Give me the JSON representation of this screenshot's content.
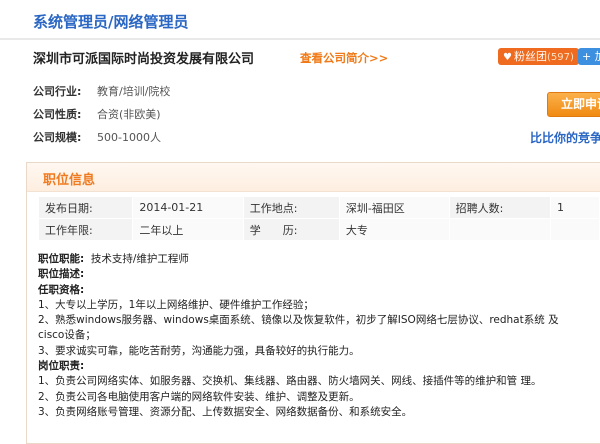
{
  "job": {
    "title": "系统管理员/网络管理员"
  },
  "company": {
    "name": "深圳市可派国际时尚投资发展有限公司",
    "intro_link": "查看公司简介>>",
    "fans_label": "粉丝团",
    "fans_count": "(597)",
    "follow_label": "+ 加关注",
    "industry_label": "公司行业:",
    "industry": "教育/培训/院校",
    "nature_label": "公司性质:",
    "nature": "合资(非欧美)",
    "scale_label": "公司规模:",
    "scale": "500-1000人",
    "apply_label": "立即申请",
    "compare_link": "比比你的竞争力"
  },
  "position": {
    "section_title": "职位信息",
    "publish_label": "发布日期:",
    "publish_date": "2014-01-21",
    "location_label": "工作地点:",
    "location": "深圳-福田区",
    "headcount_label": "招聘人数:",
    "headcount": "1",
    "experience_label": "工作年限:",
    "experience": "二年以上",
    "education_label": "学　　历:",
    "education": "大专",
    "function_label": "职位职能:",
    "function": "技术支持/维护工程师",
    "description_label": "职位描述:",
    "requirements_label": "任职资格:",
    "requirements": [
      "1、大专以上学历，1年以上网络维护、硬件维护工作经验；",
      "2、熟悉windows服务器、windows桌面系统、镜像以及恢复软件，初步了解ISO网络七层协议、redhat系统 及",
      "cisco设备；",
      "3、要求诚实可靠，能吃苦耐劳，沟通能力强，具备较好的执行能力。"
    ],
    "duties_label": "岗位职责:",
    "duties": [
      "1、负责公司网络实体、如服务器、交换机、集线器、路由器、防火墙网关、网线、接插件等的维护和管 理。",
      "2、负责公司各电脑使用客户端的网络软件安装、维护、调整及更新。",
      "3、负责网络账号管理、资源分配、上传数据安全、网络数据备份、和系统安全。"
    ]
  }
}
